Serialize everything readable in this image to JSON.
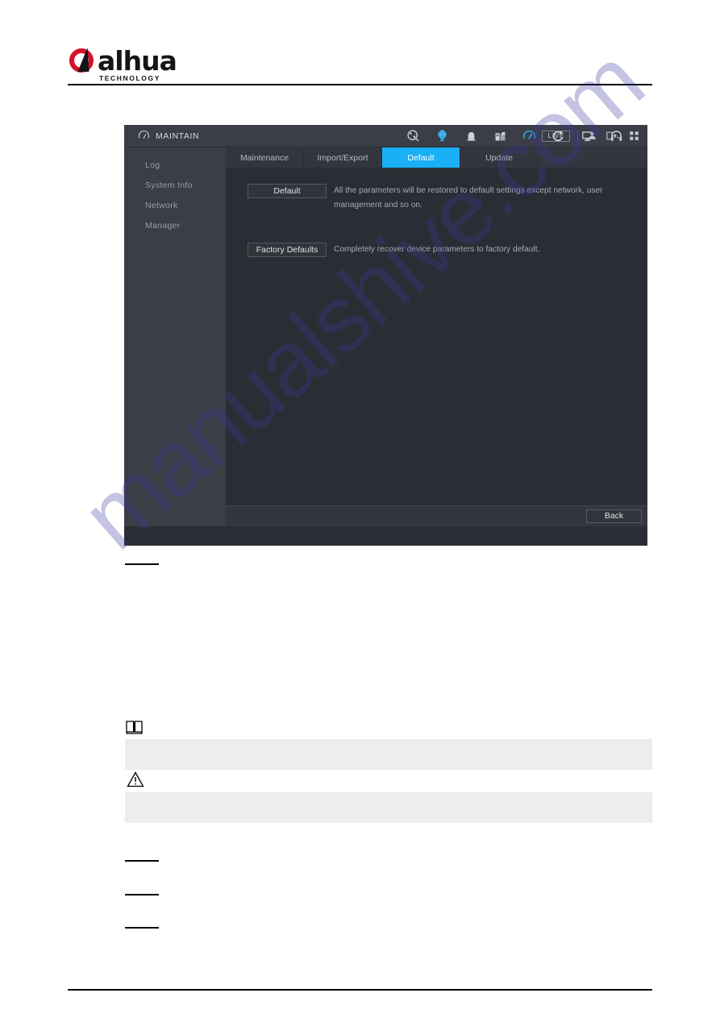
{
  "document": {
    "brand": {
      "wordmark": "alhua",
      "tagline": "TECHNOLOGY",
      "logo_red": "#d6112b",
      "logo_black": "#151515"
    },
    "watermark": "manualshive.com",
    "redacted_lines": 4,
    "callouts": [
      {
        "icon": "note-book-icon",
        "body": ""
      },
      {
        "icon": "warning-triangle-icon",
        "body": ""
      }
    ]
  },
  "ui": {
    "header": {
      "menu_icon": "gauge-icon",
      "title": "MAINTAIN",
      "nav_icons": [
        {
          "name": "camera-search-icon",
          "active": false
        },
        {
          "name": "network-globe-icon",
          "active": false
        },
        {
          "name": "storage-icon",
          "active": false
        },
        {
          "name": "device-icon",
          "active": false
        },
        {
          "name": "maintain-gauge-icon",
          "active": true
        },
        {
          "name": "backup-refresh-icon",
          "active": false
        },
        {
          "name": "display-monitor-icon",
          "active": false
        },
        {
          "name": "audio-headset-icon",
          "active": false
        }
      ],
      "live_badge": "LIVE",
      "account_icon": "user-icon",
      "logout_icon": "logout-icon",
      "grid_icon": "grid-icon",
      "accent_color": "#19b0f5"
    },
    "sidebar": {
      "items": [
        {
          "label": "Log"
        },
        {
          "label": "System Info"
        },
        {
          "label": "Network"
        },
        {
          "label": "Manager"
        }
      ]
    },
    "tabs": [
      {
        "label": "Maintenance",
        "active": false
      },
      {
        "label": "Import/Export",
        "active": false
      },
      {
        "label": "Default",
        "active": true
      },
      {
        "label": "Update",
        "active": false
      }
    ],
    "content": {
      "default_button": "Default",
      "default_description": "All the parameters will be restored to default settings except network, user management and so on.",
      "factory_button": "Factory Defaults",
      "factory_description": "Completely recover device parameters to factory default."
    },
    "footer": {
      "back_button": "Back"
    }
  }
}
